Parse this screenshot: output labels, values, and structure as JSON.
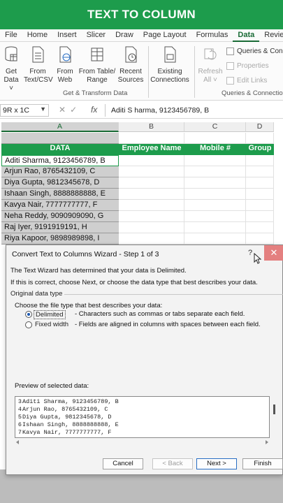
{
  "banner": {
    "title": "TEXT TO COLUMN"
  },
  "menu": {
    "tabs": [
      "File",
      "Home",
      "Insert",
      "Slicer",
      "Draw",
      "Page Layout",
      "Formulas",
      "Data",
      "Review"
    ],
    "active": "Data"
  },
  "ribbon": {
    "buttons": [
      {
        "label1": "Get",
        "label2": "Data ˅"
      },
      {
        "label1": "From",
        "label2": "Text/CSV"
      },
      {
        "label1": "From",
        "label2": "Web"
      },
      {
        "label1": "From Table/",
        "label2": "Range"
      },
      {
        "label1": "Recent",
        "label2": "Sources"
      },
      {
        "label1": "Existing",
        "label2": "Connections"
      },
      {
        "label1": "Refresh",
        "label2": "All ˅"
      }
    ],
    "group1_label": "Get & Transform Data",
    "queries": {
      "item1": "Queries & Connections",
      "item2": "Properties",
      "item3": "Edit Links",
      "group_label": "Queries & Connections"
    }
  },
  "formula_bar": {
    "name_box": "9R x 1C",
    "content": "Aditi S harma, 9123456789, B",
    "fx": "fx",
    "cancel": "✕",
    "enter": "✓"
  },
  "columns": [
    "A",
    "B",
    "C",
    "D"
  ],
  "sheet": {
    "headers": [
      "DATA",
      "Employee Name",
      "Mobile #",
      "Group"
    ],
    "rows": [
      "Aditi Sharma, 9123456789, B",
      "Arjun Rao, 8765432109, C",
      "Diya Gupta, 9812345678, D",
      "Ishaan Singh, 8888888888, E",
      "Kavya Nair, 7777777777, F",
      "Neha Reddy, 9090909090, G",
      "Raj Iyer, 9191919191, H",
      "Riya Kapoor, 9898989898, I"
    ]
  },
  "dialog": {
    "title": "Convert Text to Columns Wizard - Step 1 of 3",
    "help": "?",
    "close": "✕",
    "intro": "The Text Wizard has determined that your data is Delimited.",
    "instruction": "If this is correct, choose Next, or choose the data type that best describes your data.",
    "group_title": "Original data type",
    "choose_prompt": "Choose the file type that best describes your data:",
    "options": [
      {
        "label": "Delimited",
        "desc": "- Characters such as commas or tabs separate each field.",
        "selected": true
      },
      {
        "label": "Fixed width",
        "desc": "- Fields are aligned in columns with spaces between each field.",
        "selected": false
      }
    ],
    "preview_label": "Preview of selected data:",
    "preview": [
      {
        "num": "3",
        "text": "Aditi Sharma, 9123456789, B"
      },
      {
        "num": "4",
        "text": "Arjun Rao, 8765432109, C"
      },
      {
        "num": "5",
        "text": "Diya Gupta, 9812345678, D"
      },
      {
        "num": "6",
        "text": "Ishaan Singh, 8888888888, E"
      },
      {
        "num": "7",
        "text": "Kavya Nair, 7777777777, F"
      }
    ],
    "buttons": {
      "cancel": "Cancel",
      "back": "< Back",
      "next": "Next >",
      "finish": "Finish"
    }
  },
  "colors": {
    "accent": "#1d9c4c",
    "close": "#e48080",
    "link": "#1a56b0"
  }
}
